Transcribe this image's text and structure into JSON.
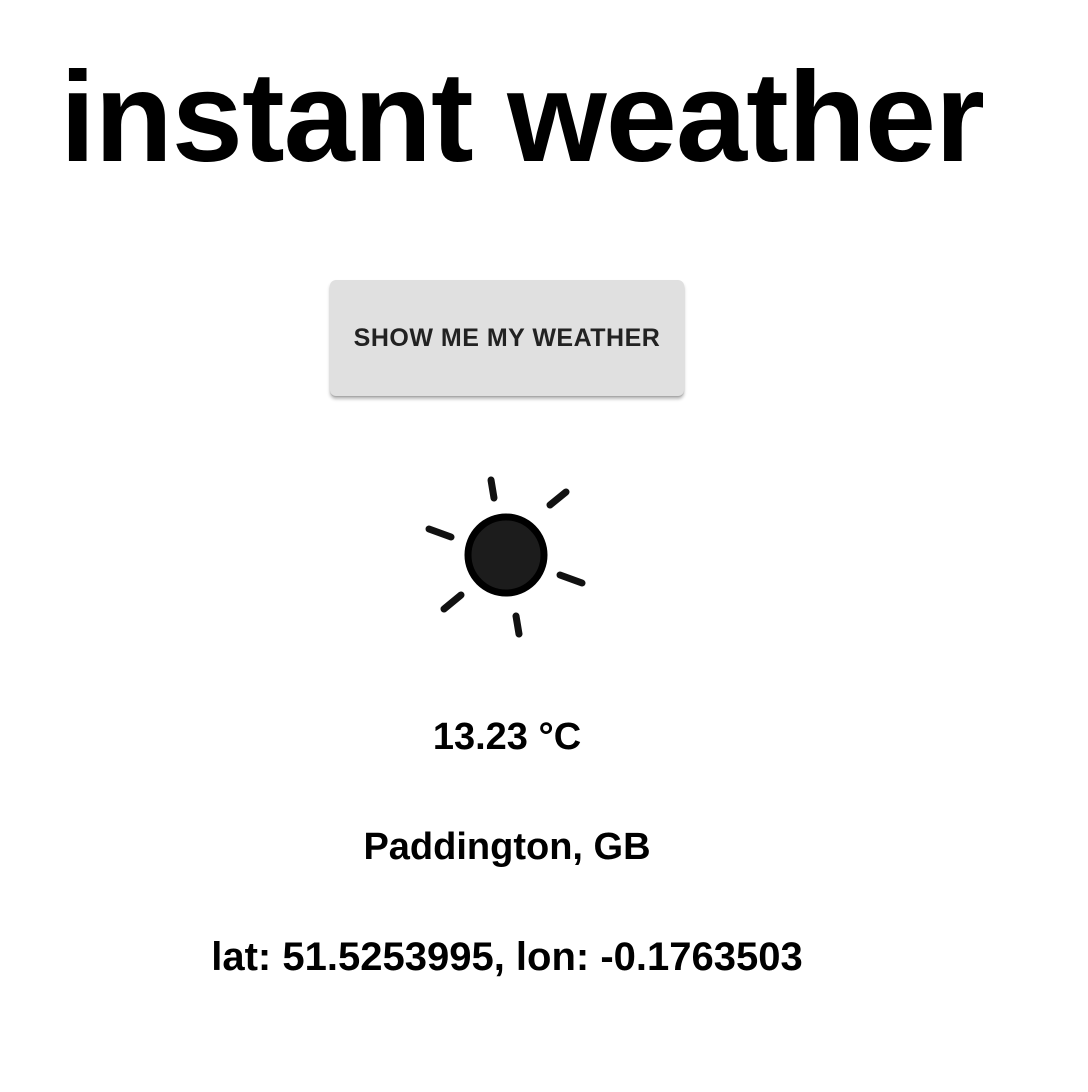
{
  "app": {
    "title": "instant weather"
  },
  "button": {
    "label": "SHOW ME MY WEATHER"
  },
  "weather": {
    "icon": "sun-icon",
    "temperature": "13.23 °C",
    "location": "Paddington, GB",
    "coordinates": "lat: 51.5253995, lon: -0.1763503"
  }
}
